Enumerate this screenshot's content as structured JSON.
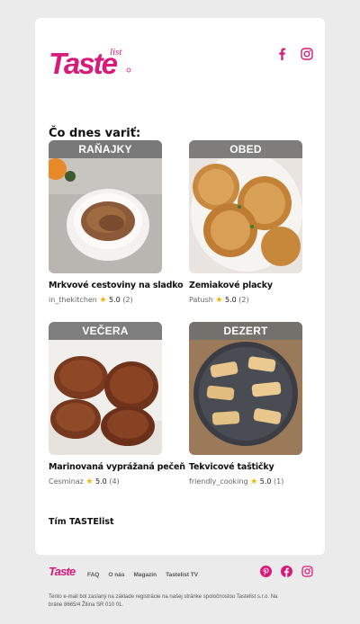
{
  "brand": {
    "logo_main": "Taste",
    "logo_sub": "list",
    "color": "#d81b7a"
  },
  "social": {
    "top": [
      "facebook-icon",
      "instagram-icon"
    ],
    "bottom": [
      "pinterest-icon",
      "facebook-icon",
      "instagram-icon"
    ]
  },
  "heading": "Čo dnes variť:",
  "recipes": [
    {
      "category": "RAŇAJKY",
      "title": "Mrkvové cestoviny na sladko",
      "author": "in_thekitchen",
      "rating": "5.0",
      "count": "(2)"
    },
    {
      "category": "OBED",
      "title": "Zemiakové placky",
      "author": "Patush",
      "rating": "5.0",
      "count": "(2)"
    },
    {
      "category": "VEČERA",
      "title": "Marinovaná vyprážaná pečeň",
      "author": "Cesminaz",
      "rating": "5.0",
      "count": "(4)"
    },
    {
      "category": "DEZERT",
      "title": "Tekvicové taštičky",
      "author": "friendly_cooking",
      "rating": "5.0",
      "count": "(1)"
    }
  ],
  "signoff": "Tím TASTElist",
  "footer": {
    "nav": [
      "FAQ",
      "O nás",
      "Magazín",
      "Tastelist TV"
    ],
    "legal": "Tento e-mail bol zaslaný na základe registrácie na našej stránke spoločnostou Tastelist s.r.o. Na bráne 8665/4 Žilina SR 010 01."
  }
}
